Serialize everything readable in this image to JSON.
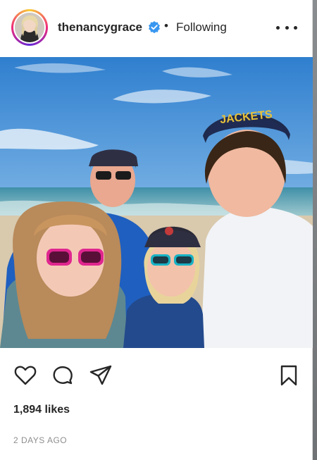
{
  "post": {
    "username": "thenancygrace",
    "verified": true,
    "separator": "•",
    "follow_status": "Following",
    "likes": "1,894 likes",
    "time_ago": "2 DAYS AGO"
  },
  "photo": {
    "cap_text": "JACKETS"
  },
  "icons": {
    "like": "heart-icon",
    "comment": "comment-icon",
    "share": "share-icon",
    "save": "bookmark-icon",
    "more": "more-options-icon",
    "verified": "verified-badge-icon"
  },
  "colors": {
    "verified": "#3897f0",
    "text": "#262626",
    "muted": "#8e8e8e",
    "story_ring": "#ee2a7b"
  }
}
